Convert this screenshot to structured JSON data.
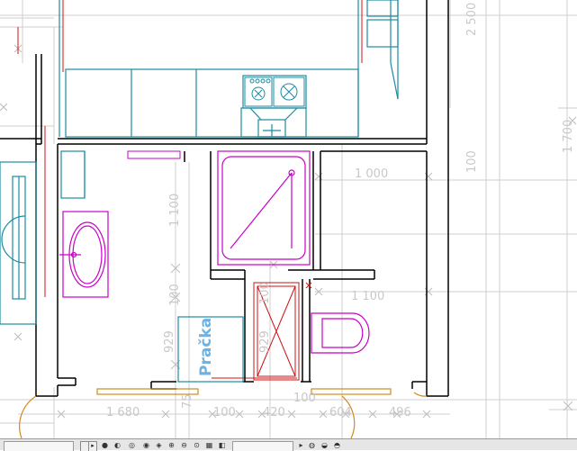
{
  "labels": {
    "washing_machine": "Pračka"
  },
  "dimensions": {
    "d2500": "2 500",
    "d1700": "1 700",
    "d100_right": "100",
    "d1000": "1 000",
    "d1100_top": "1 100",
    "d1100_mid": "1 100",
    "d100_left": "100",
    "d100_shaft": "100",
    "d929_a": "929",
    "d929_b": "929",
    "d75": "75",
    "d1680": "1 680",
    "d100_bottom": "100",
    "d420": "420",
    "d100_bottom2": "100",
    "d604": "604",
    "d496": "496"
  },
  "toolbar": {
    "next_button": "▸"
  },
  "colors": {
    "wall": "#000000",
    "furniture": "#1a8ca0",
    "sanitary": "#c800c8",
    "grid": "#c8c8c8",
    "door": "#d08a20",
    "hatch": "#d01010"
  }
}
